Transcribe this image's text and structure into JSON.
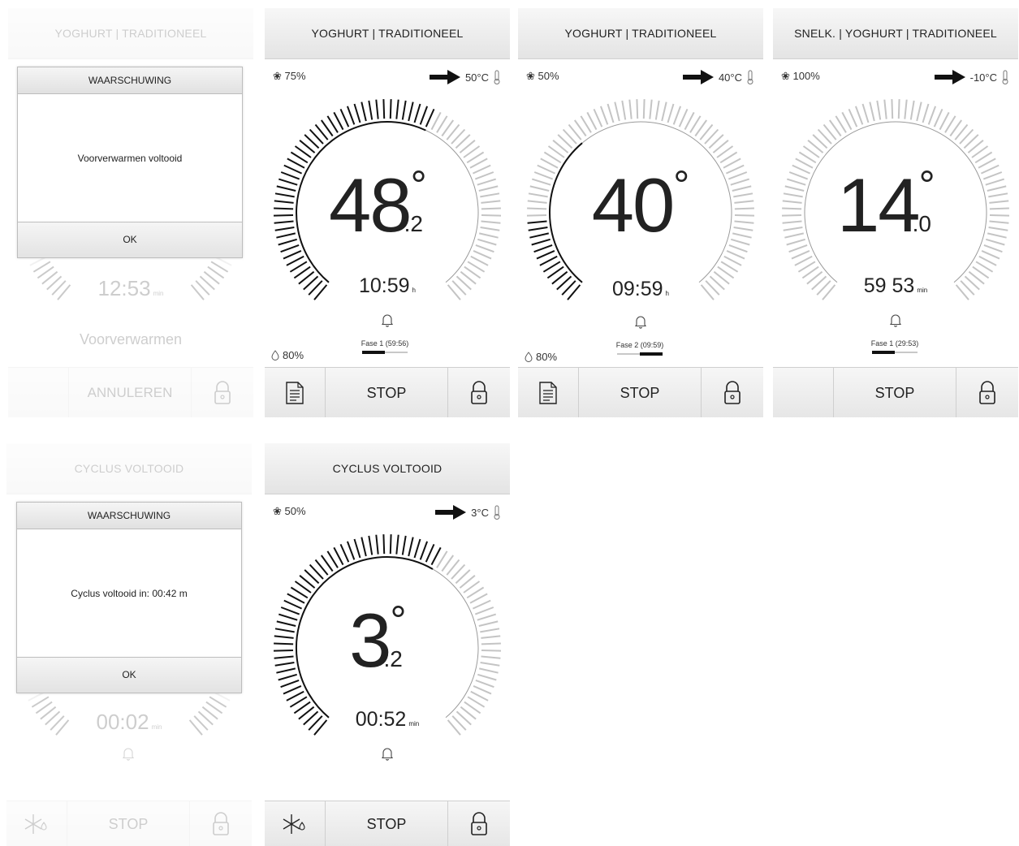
{
  "panels": {
    "p1": {
      "title": "YOGHURT | TRADITIONEEL",
      "time": "12:53",
      "time_unit": "min",
      "status": "Voorverwarmen",
      "cancel_label": "ANNULEREN",
      "modal": {
        "title": "WAARSCHUWING",
        "message": "Voorverwarmen voltooid",
        "ok": "OK"
      }
    },
    "p2": {
      "title": "YOGHURT | TRADITIONEEL",
      "fan": "75%",
      "target": "50°C",
      "temp_int": "48",
      "temp_dec": ".2",
      "deg": "°",
      "time": "10:59",
      "time_unit": "h",
      "humidity": "80%",
      "phase_label": "Fase 1 (59:56)",
      "phase_progress": 0.5,
      "stop": "STOP"
    },
    "p3": {
      "title": "YOGHURT | TRADITIONEEL",
      "fan": "50%",
      "target": "40°C",
      "temp_int": "40",
      "temp_dec": "",
      "deg": "°",
      "time": "09:59",
      "time_unit": "h",
      "humidity": "80%",
      "phase_label": "Fase 2 (09:59)",
      "phase_progress": 0.5,
      "stop": "STOP"
    },
    "p4": {
      "title": "SNELK. | YOGHURT | TRADITIONEEL",
      "fan": "100%",
      "target": "-10°C",
      "temp_int": "14",
      "temp_dec": ".0",
      "deg": "°",
      "time": "59 53",
      "time_unit": "min",
      "phase_label": "Fase 1 (29:53)",
      "phase_progress": 0.5,
      "stop": "STOP"
    },
    "p5": {
      "title": "CYCLUS VOLTOOID",
      "time": "00:02",
      "time_unit": "min",
      "stop": "STOP",
      "modal": {
        "title": "WAARSCHUWING",
        "message": "Cyclus voltooid in: 00:42 m",
        "ok": "OK"
      }
    },
    "p6": {
      "title": "CYCLUS VOLTOOID",
      "fan": "50%",
      "target": "3°C",
      "temp_int": "3",
      "temp_dec": ".2",
      "deg": "°",
      "time": "00:52",
      "time_unit": "min",
      "stop": "STOP"
    }
  },
  "icons": {
    "fan": "fan-icon",
    "arrow": "arrow-right-icon",
    "thermometer": "thermometer-icon",
    "bell": "bell-icon",
    "drop": "drop-icon",
    "document": "document-icon",
    "lock": "lock-icon",
    "snowflake": "snowflake-icon"
  },
  "colors": {
    "text": "#222222",
    "tick_dark": "#111111",
    "tick_light": "#c4c4c4",
    "header_bg": "#ececec"
  }
}
